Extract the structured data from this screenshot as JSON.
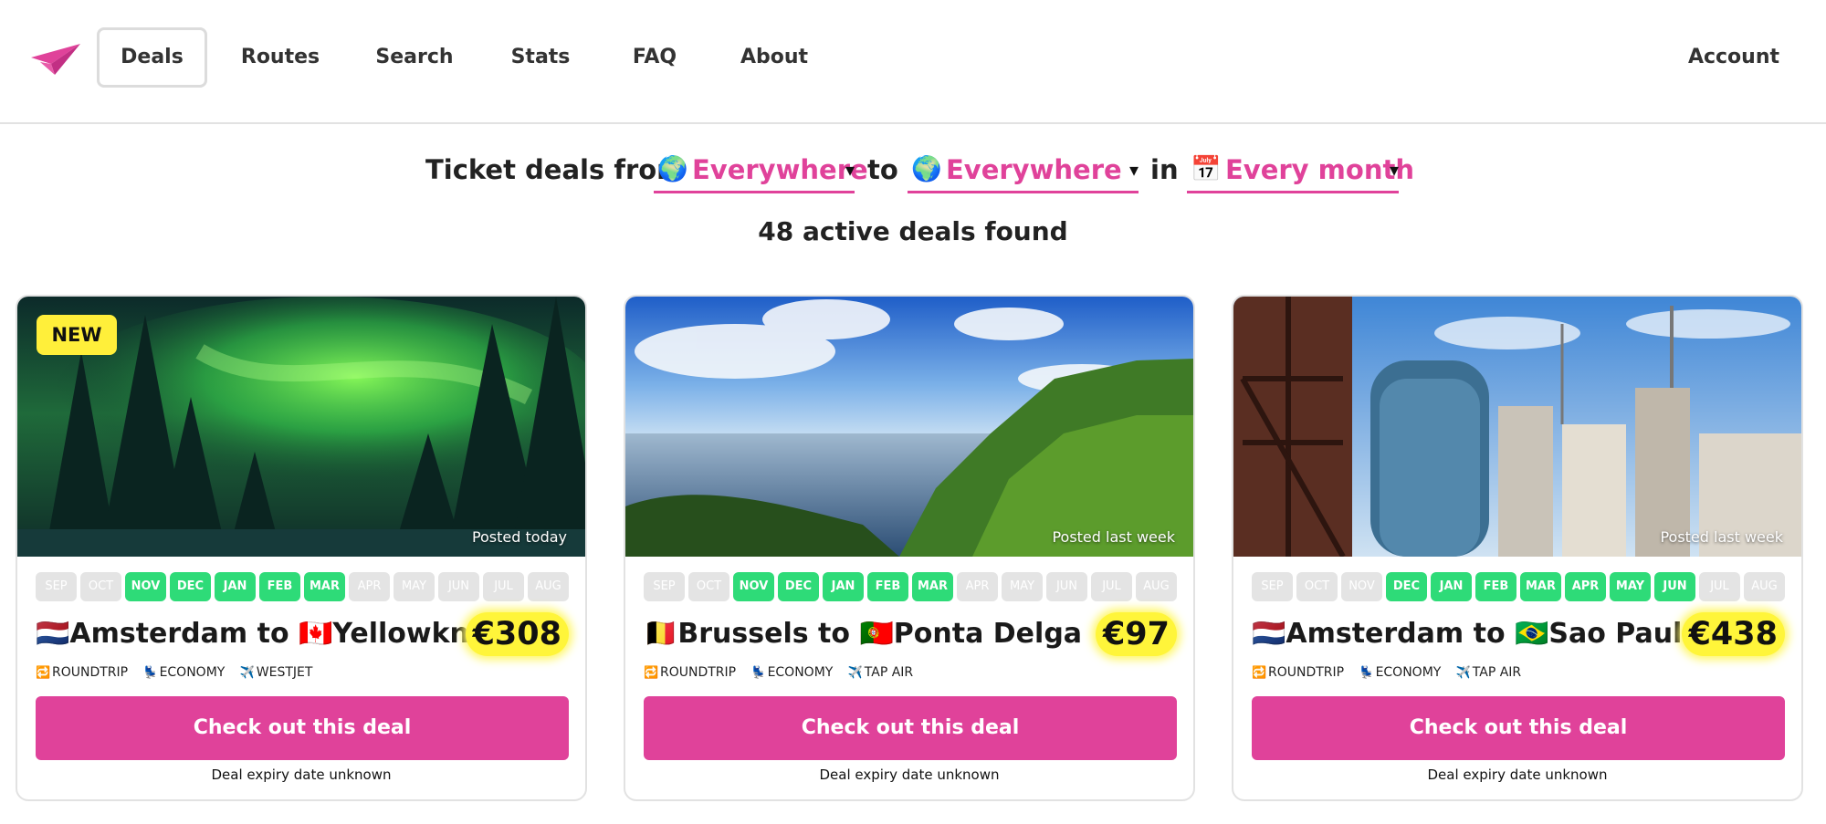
{
  "nav": {
    "logo_icon": "paper-plane-icon",
    "items": [
      "Deals",
      "Routes",
      "Search",
      "Stats",
      "FAQ",
      "About"
    ],
    "active": "Deals",
    "account": "Account"
  },
  "filter": {
    "from_label": "Ticket deals from",
    "origin": {
      "icon": "🌍",
      "value": "Everywhere"
    },
    "to_label": "to",
    "destination": {
      "icon": "🌍",
      "value": "Everywhere"
    },
    "in_label": "in",
    "month": {
      "icon": "📅",
      "value": "Every month"
    },
    "caret": "▾"
  },
  "results": {
    "count_text": "48 active deals found"
  },
  "colors": {
    "accent": "#e0429a",
    "month_on": "#2edb78",
    "month_off": "#e4e4e4",
    "highlight": "#fff53a"
  },
  "month_labels": [
    "SEP",
    "OCT",
    "NOV",
    "DEC",
    "JAN",
    "FEB",
    "MAR",
    "APR",
    "MAY",
    "JUN",
    "JUL",
    "AUG"
  ],
  "deals": [
    {
      "badge": "NEW",
      "posted": "Posted today",
      "active_months": [
        false,
        false,
        true,
        true,
        true,
        true,
        true,
        false,
        false,
        false,
        false,
        false
      ],
      "origin_flag": "🇳🇱",
      "origin": "Amsterdam",
      "connector": "to",
      "dest_flag": "🇨🇦",
      "destination": "Yellowknife",
      "price": "€308",
      "trip_icon": "🔁",
      "trip": "ROUNDTRIP",
      "class_icon": "💺",
      "class": "ECONOMY",
      "airline_icon": "✈️",
      "airline": "WESTJET",
      "cta": "Check out this deal",
      "expiry": "Deal expiry date unknown"
    },
    {
      "badge": "",
      "posted": "Posted last week",
      "active_months": [
        false,
        false,
        true,
        true,
        true,
        true,
        true,
        false,
        false,
        false,
        false,
        false
      ],
      "origin_flag": "🇧🇪",
      "origin": "Brussels",
      "connector": "to",
      "dest_flag": "🇵🇹",
      "destination": "Ponta Delgada",
      "price": "€97",
      "trip_icon": "🔁",
      "trip": "ROUNDTRIP",
      "class_icon": "💺",
      "class": "ECONOMY",
      "airline_icon": "✈️",
      "airline": "TAP AIR",
      "cta": "Check out this deal",
      "expiry": "Deal expiry date unknown"
    },
    {
      "badge": "",
      "posted": "Posted last week",
      "active_months": [
        false,
        false,
        false,
        true,
        true,
        true,
        true,
        true,
        true,
        true,
        false,
        false
      ],
      "origin_flag": "🇳🇱",
      "origin": "Amsterdam",
      "connector": "to",
      "dest_flag": "🇧🇷",
      "destination": "Sao Paulo",
      "price": "€438",
      "trip_icon": "🔁",
      "trip": "ROUNDTRIP",
      "class_icon": "💺",
      "class": "ECONOMY",
      "airline_icon": "✈️",
      "airline": "TAP AIR",
      "cta": "Check out this deal",
      "expiry": "Deal expiry date unknown"
    }
  ]
}
